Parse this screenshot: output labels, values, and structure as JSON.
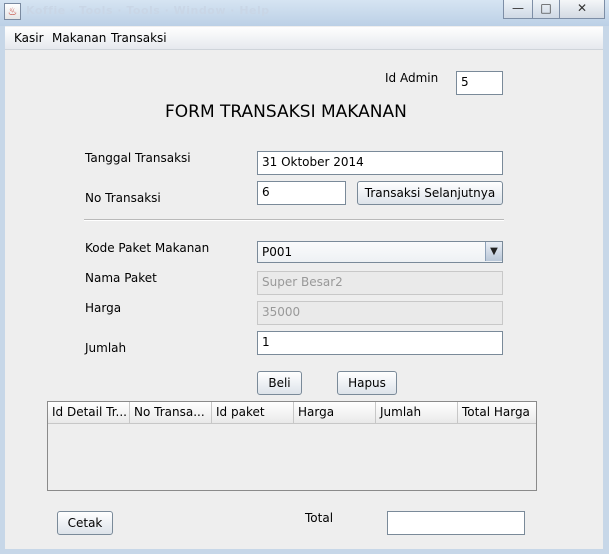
{
  "window": {
    "ghost_title": "Koffie · Tools · Tools · Window · Help",
    "buttons": {
      "minimize": "—",
      "maximize": "□",
      "close": "✕"
    }
  },
  "menu": [
    "Kasir",
    "Makanan",
    "Transaksi"
  ],
  "admin": {
    "label": "Id Admin",
    "value": "5"
  },
  "form_title": "FORM TRANSAKSI MAKANAN",
  "fields": {
    "tanggal": {
      "label": "Tanggal Transaksi",
      "value": "31 Oktober 2014"
    },
    "no_transaksi": {
      "label": "No Transaksi",
      "value": "6"
    },
    "next_button": "Transaksi Selanjutnya",
    "kode_paket": {
      "label": "Kode Paket Makanan",
      "value": "P001"
    },
    "nama_paket": {
      "label": "Nama Paket",
      "value": "Super Besar2"
    },
    "harga": {
      "label": "Harga",
      "value": "35000"
    },
    "jumlah": {
      "label": "Jumlah",
      "value": "1"
    }
  },
  "buttons": {
    "beli": "Beli",
    "hapus": "Hapus",
    "cetak": "Cetak"
  },
  "table": {
    "columns": [
      "Id Detail Tr...",
      "No Transa...",
      "Id paket",
      "Harga",
      "Jumlah",
      "Total Harga"
    ],
    "rows": []
  },
  "total": {
    "label": "Total",
    "value": ""
  },
  "icons": {
    "app": "java-icon",
    "dropdown": "chevron-down-icon"
  }
}
